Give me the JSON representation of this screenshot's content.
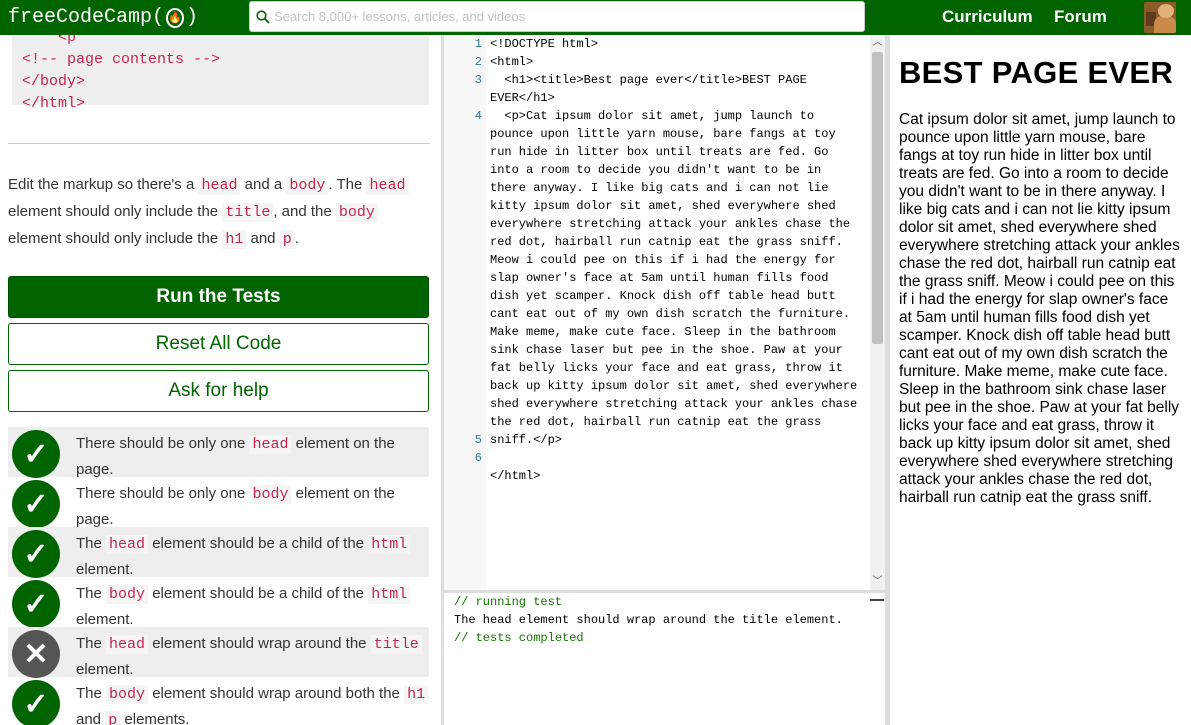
{
  "navbar": {
    "logo_text": "freeCodeCamp",
    "flame_icon": "🔥",
    "search_placeholder": "Search 8,000+ lessons, articles, and videos",
    "links": [
      "Curriculum",
      "Forum"
    ],
    "accent_color": "#006400"
  },
  "left": {
    "code_lines": [
      "    <p",
      "<!-- page contents -->",
      "</body>",
      "</html>"
    ],
    "instructions": {
      "p1": "Edit the markup so there's a",
      "c1": "head",
      "p2": "and a",
      "c2": "body",
      "p3": ". The",
      "c3": "head",
      "p4": "element should only include the",
      "c4": "title",
      "p5": ", and the",
      "c5": "body",
      "p6": "element should only include the",
      "c6": "h1",
      "p7": "and",
      "c7": "p",
      "p8": "."
    },
    "buttons": {
      "run": "Run the Tests",
      "reset": "Reset All Code",
      "help": "Ask for help"
    },
    "tests": [
      {
        "status": "pass",
        "a": "There should be only one",
        "c1": "head",
        "b": "element on the page.",
        "c2": "",
        "d": ""
      },
      {
        "status": "pass",
        "a": "There should be only one",
        "c1": "body",
        "b": "element on the page.",
        "c2": "",
        "d": ""
      },
      {
        "status": "pass",
        "a": "The",
        "c1": "head",
        "b": "element should be a child of the",
        "c2": "html",
        "d": "element."
      },
      {
        "status": "pass",
        "a": "The",
        "c1": "body",
        "b": "element should be a child of the",
        "c2": "html",
        "d": "element."
      },
      {
        "status": "fail",
        "a": "The",
        "c1": "head",
        "b": "element should wrap around the",
        "c2": "title",
        "d": "element."
      },
      {
        "status": "pass",
        "a": "The",
        "c1": "body",
        "b": "element should wrap around both the",
        "c2": "h1",
        "d": "and",
        "c3": "p",
        "e": "elements."
      }
    ]
  },
  "editor": {
    "line_numbers": [
      "1",
      "2",
      "3",
      "",
      "4",
      "",
      "",
      "",
      "",
      "",
      "",
      "",
      "",
      "",
      "",
      "",
      "",
      "",
      "",
      "",
      "",
      "",
      "5",
      "6"
    ],
    "lines": [
      "<!DOCTYPE html>",
      "<html>",
      "  <h1><title>Best page ever</title>BEST PAGE",
      "EVER</h1>",
      "  <p>Cat ipsum dolor sit amet, jump launch to",
      "pounce upon little yarn mouse, bare fangs at toy",
      "run hide in litter box until treats are fed. Go",
      "into a room to decide you didn't want to be in",
      "there anyway. I like big cats and i can not lie",
      "kitty ipsum dolor sit amet, shed everywhere shed",
      "everywhere stretching attack your ankles chase the",
      "red dot, hairball run catnip eat the grass sniff.",
      "Meow i could pee on this if i had the energy for",
      "slap owner's face at 5am until human fills food",
      "dish yet scamper. Knock dish off table head butt",
      "cant eat out of my own dish scratch the furniture.",
      "Make meme, make cute face. Sleep in the bathroom",
      "sink chase laser but pee in the shoe. Paw at your",
      "fat belly licks your face and eat grass, throw it",
      "back up kitty ipsum dolor sit amet, shed everywhere",
      "shed everywhere stretching attack your ankles chase",
      "the red dot, hairball run catnip eat the grass",
      "sniff.</p>",
      "",
      "</html>"
    ]
  },
  "output": {
    "lines": [
      {
        "text": "// running test",
        "type": "comment"
      },
      {
        "text": "The head element should wrap around the title element.",
        "type": "plain"
      },
      {
        "text": "// tests completed",
        "type": "comment"
      }
    ]
  },
  "preview": {
    "heading": "BEST PAGE EVER",
    "paragraph": "Cat ipsum dolor sit amet, jump launch to pounce upon little yarn mouse, bare fangs at toy run hide in litter box until treats are fed. Go into a room to decide you didn't want to be in there anyway. I like big cats and i can not lie kitty ipsum dolor sit amet, shed everywhere shed everywhere stretching attack your ankles chase the red dot, hairball run catnip eat the grass sniff. Meow i could pee on this if i had the energy for slap owner's face at 5am until human fills food dish yet scamper. Knock dish off table head butt cant eat out of my own dish scratch the furniture. Make meme, make cute face. Sleep in the bathroom sink chase laser but pee in the shoe. Paw at your fat belly licks your face and eat grass, throw it back up kitty ipsum dolor sit amet, shed everywhere shed everywhere stretching attack your ankles chase the red dot, hairball run catnip eat the grass sniff."
  }
}
